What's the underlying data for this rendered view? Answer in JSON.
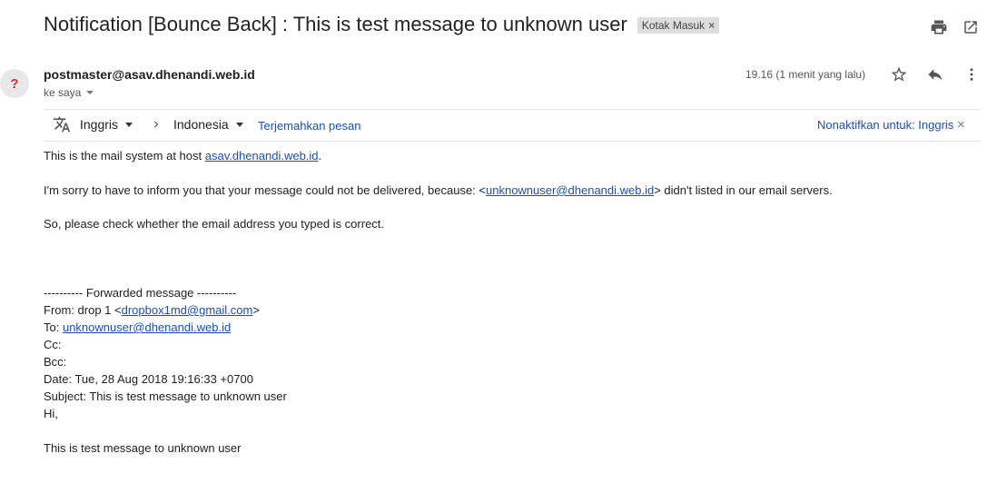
{
  "header": {
    "subject": "Notification [Bounce Back] : This is test message to unknown user",
    "label": "Kotak Masuk",
    "label_close": "×"
  },
  "message": {
    "avatar_glyph": "?",
    "sender": "postmaster@asav.dhenandi.web.id",
    "recipient": "ke saya",
    "time": "19.16 (1 menit yang lalu)"
  },
  "translate": {
    "from_lang": "Inggris",
    "to_lang": "Indonesia",
    "translate_link": "Terjemahkan pesan",
    "disable_link": "Nonaktifkan untuk: Inggris",
    "close": "×"
  },
  "body": {
    "line1_pre": "This is the mail system at host ",
    "line1_link": "asav.dhenandi.web.id",
    "line1_post": ".",
    "line2_pre": "I'm sorry to have to inform you that your message could not be delivered, because: <",
    "line2_link": "unknownuser@dhenandi.web.id",
    "line2_post": "> didn't listed in our email servers.",
    "line3": "So, please check whether the email address you typed is correct.",
    "fwd_header": "---------- Forwarded message ----------",
    "from_pre": "From: drop 1 <",
    "from_link": "dropbox1md@gmail.com",
    "from_post": ">",
    "to_pre": "To: ",
    "to_link": "unknownuser@dhenandi.web.id",
    "cc": "Cc:",
    "bcc": "Bcc:",
    "date": "Date: Tue, 28 Aug 2018 19:16:33 +0700",
    "subject": "Subject: This is test message to unknown user",
    "hi": "Hi,",
    "closing": "This is test message to unknown user"
  },
  "icons": {
    "print": "print-icon",
    "open_new": "open-in-new-window-icon",
    "star": "star-icon",
    "reply": "reply-icon",
    "more": "more-vert-icon",
    "translate": "translate-icon",
    "arrow": "chevron-right-icon"
  }
}
